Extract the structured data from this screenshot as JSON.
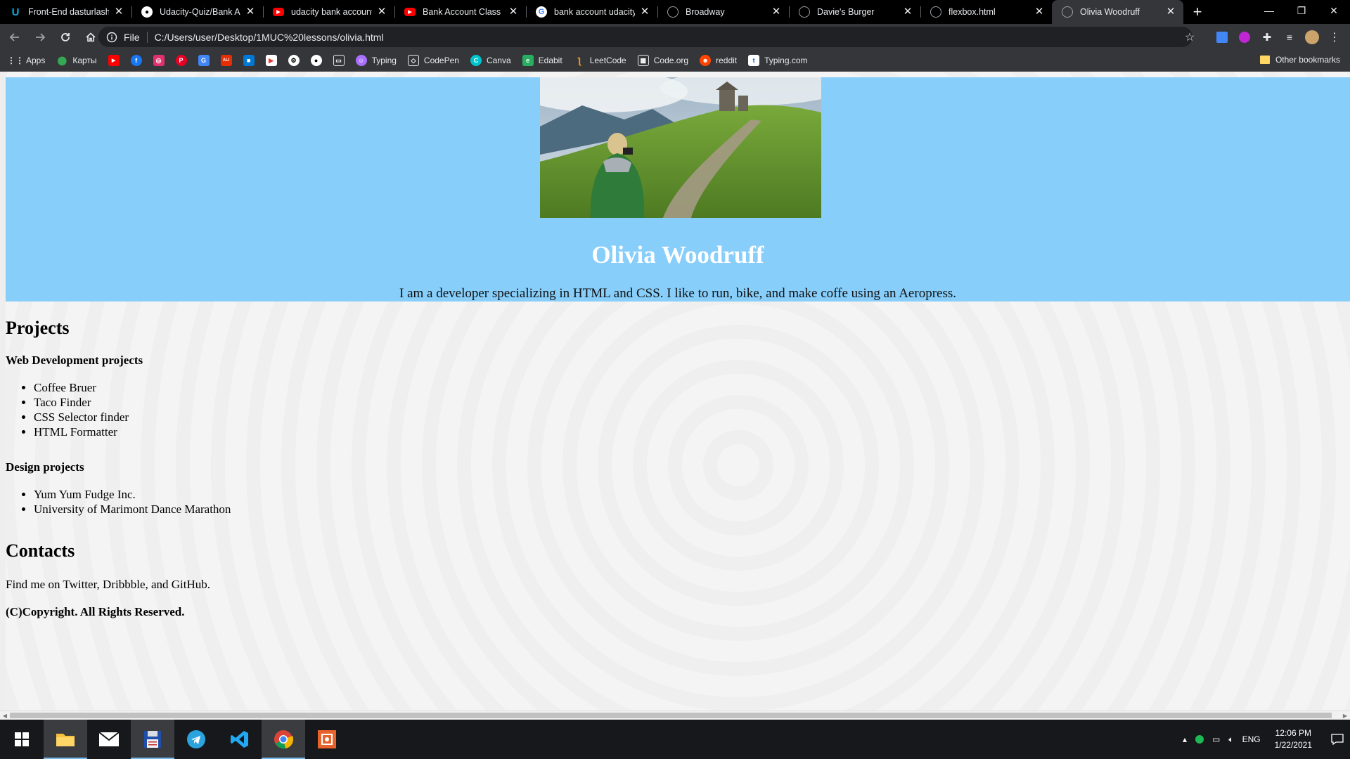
{
  "tabs": [
    {
      "title": "Front-End dasturlash tr",
      "icon": "udacity-icon",
      "color": "#02b3e4"
    },
    {
      "title": "Udacity-Quiz/Bank Acc",
      "icon": "github-icon",
      "color": "#ffffff"
    },
    {
      "title": "udacity bank accounts",
      "icon": "youtube-icon",
      "color": "#ff0000"
    },
    {
      "title": "Bank Account Class - Yo",
      "icon": "youtube-icon",
      "color": "#ff0000"
    },
    {
      "title": "bank account udacity -",
      "icon": "google-icon",
      "color": "#4285f4"
    },
    {
      "title": "Broadway",
      "icon": "globe-icon",
      "color": "#9aa0a6"
    },
    {
      "title": "Davie's Burger",
      "icon": "globe-icon",
      "color": "#9aa0a6"
    },
    {
      "title": "flexbox.html",
      "icon": "globe-icon",
      "color": "#9aa0a6"
    },
    {
      "title": "Olivia Woodruff",
      "icon": "globe-icon",
      "color": "#9aa0a6",
      "active": true
    }
  ],
  "address": {
    "scheme": "File",
    "url": "C:/Users/user/Desktop/1MUC%20lessons/olivia.html"
  },
  "bookmarks": {
    "apps": "Apps",
    "maps": "Карты",
    "typing": "Typing",
    "codepen": "CodePen",
    "canva": "Canva",
    "edabit": "Edabit",
    "leetcode": "LeetCode",
    "codeorg": "Code.org",
    "reddit": "reddit",
    "typingcom": "Typing.com",
    "other": "Other bookmarks"
  },
  "page": {
    "name": "Olivia Woodruff",
    "bio": "I am a developer specializing in HTML and CSS. I like to run, bike, and make coffe using an Aeropress.",
    "projects_heading": "Projects",
    "web_heading": "Web Development projects",
    "web_projects": [
      "Coffee Bruer",
      "Taco Finder",
      "CSS Selector finder",
      "HTML Formatter"
    ],
    "design_heading": "Design projects",
    "design_projects": [
      "Yum Yum Fudge Inc.",
      "University of Marimont Dance Marathon"
    ],
    "contacts_heading": "Contacts",
    "contacts_text": "Find me on Twitter, Dribbble, and GitHub.",
    "copyright": "(C)Copyright. All Rights Reserved."
  },
  "tray": {
    "language": "ENG",
    "time": "12:06 PM",
    "date": "1/22/2021"
  },
  "colors": {
    "hero_bg": "#87cefa",
    "hero_title": "#ffffff",
    "tab_active": "#35363a",
    "tab_strip": "#000000"
  }
}
